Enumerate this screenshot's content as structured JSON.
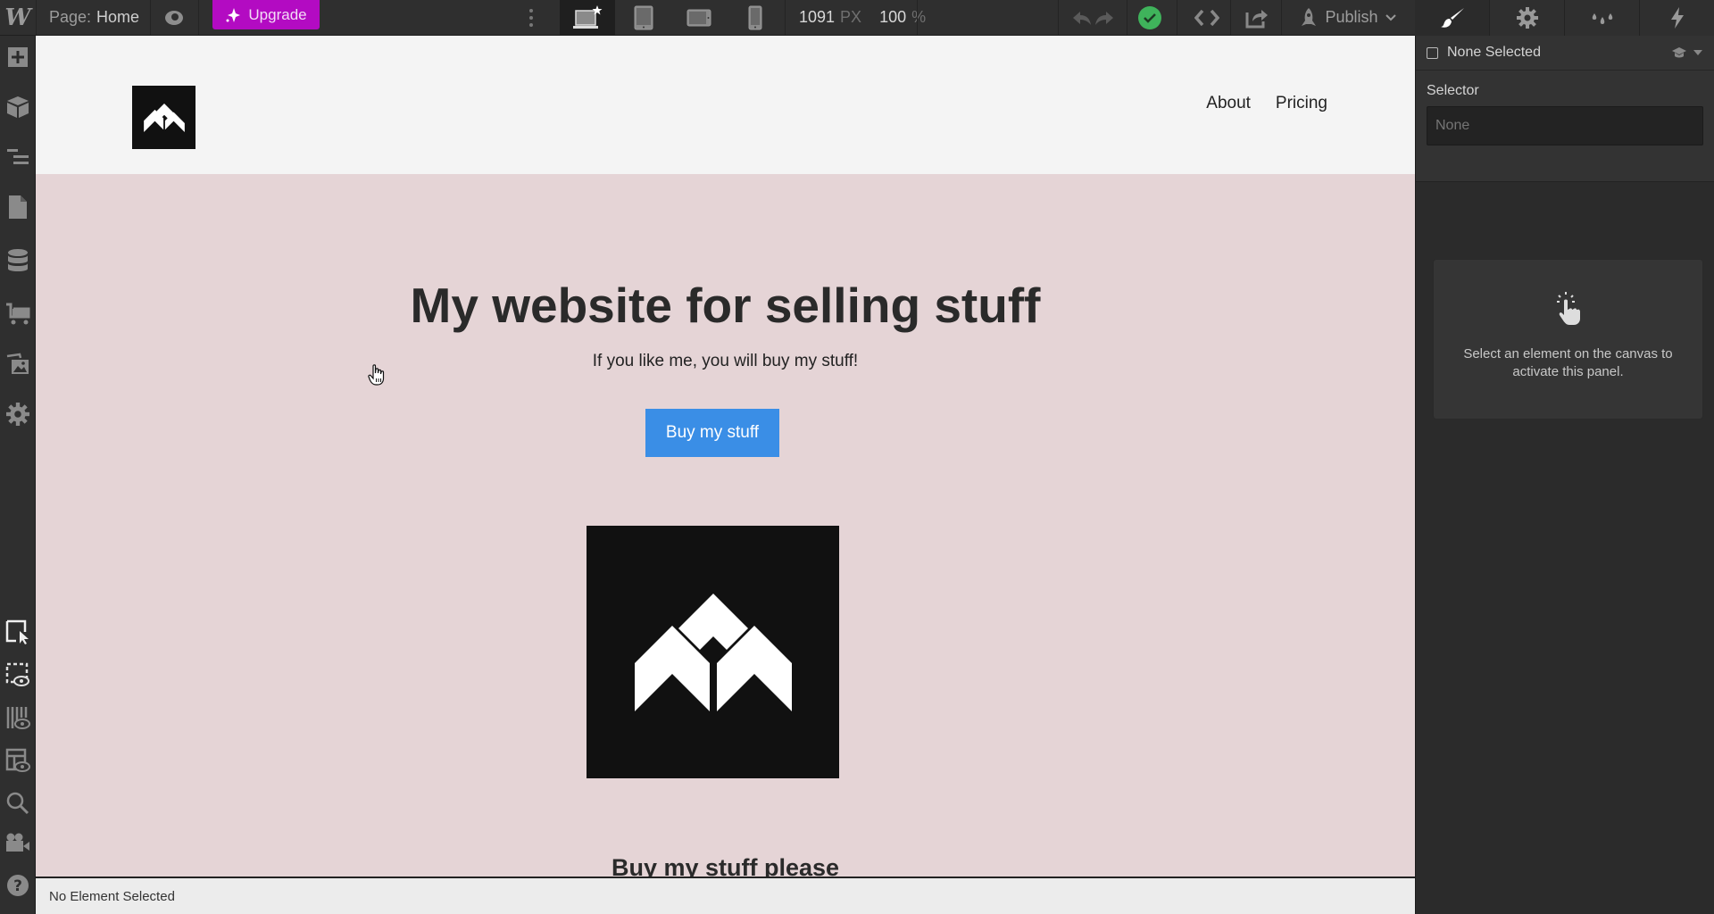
{
  "topbar": {
    "logo": "W",
    "page_prefix": "Page:",
    "page_name": "Home",
    "upgrade_label": "Upgrade",
    "breakpoints": [
      "desktop",
      "tablet",
      "mobile-landscape",
      "mobile-portrait"
    ],
    "active_breakpoint": "desktop",
    "width_value": "1091",
    "width_unit": "PX",
    "zoom_value": "100",
    "zoom_unit": "%",
    "publish_label": "Publish",
    "status_color": "#3fb35b",
    "upgrade_color": "#b30bc2"
  },
  "right_tabs": [
    "style-brush",
    "settings-gear",
    "style-manager-drops",
    "interactions-bolt"
  ],
  "left_toolbar": {
    "top": [
      "add",
      "components",
      "navigator",
      "pages",
      "cms",
      "ecommerce",
      "assets",
      "settings"
    ],
    "bottom": [
      "select",
      "show-element-edges",
      "x-ray",
      "preview-layout",
      "search",
      "video-tutorials",
      "help"
    ]
  },
  "canvas": {
    "nav_links": [
      "About",
      "Pricing"
    ],
    "hero_title": "My website for selling stuff",
    "hero_subtitle": "If you like me, you will buy my stuff!",
    "hero_button": "Buy my stuff",
    "section_heading": "Buy my stuff please",
    "accent_color": "#3a8ee6"
  },
  "status_bar": {
    "text": "No Element Selected"
  },
  "right_panel": {
    "selection_label": "None Selected",
    "selector_label": "Selector",
    "selector_placeholder": "None",
    "empty_message": "Select an element on the canvas to activate this panel."
  }
}
